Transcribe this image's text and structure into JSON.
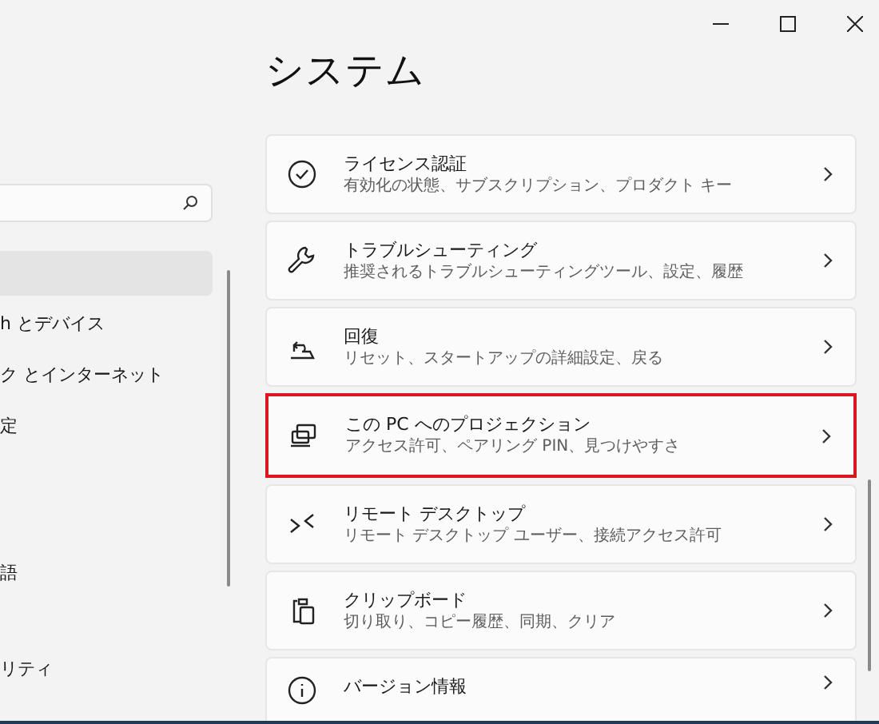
{
  "sidebar": {
    "items": [
      {
        "selected": true
      },
      {
        "label": "h とデバイス",
        "selected": false
      },
      {
        "label": "ク とインターネット",
        "selected": false
      },
      {
        "label": "定",
        "selected": false
      },
      {
        "label": "語",
        "selected": false
      },
      {
        "label": "リティ",
        "selected": false
      }
    ]
  },
  "page_title": "システム",
  "cards": [
    {
      "title": "ライセンス認証",
      "subtitle": "有効化の状態、サブスクリプション、プロダクト キー",
      "highlighted": false
    },
    {
      "title": "トラブルシューティング",
      "subtitle": "推奨されるトラブルシューティングツール、設定、履歴",
      "highlighted": false
    },
    {
      "title": "回復",
      "subtitle": "リセット、スタートアップの詳細設定、戻る",
      "highlighted": false
    },
    {
      "title": "この PC へのプロジェクション",
      "subtitle": "アクセス許可、ペアリング PIN、見つけやすさ",
      "highlighted": true
    },
    {
      "title": "リモート デスクトップ",
      "subtitle": "リモート デスクトップ ユーザー、接続アクセス許可",
      "highlighted": false
    },
    {
      "title": "クリップボード",
      "subtitle": "切り取り、コピー履歴、同期、クリア",
      "highlighted": false
    },
    {
      "title": "バージョン情報",
      "highlighted": false
    }
  ]
}
